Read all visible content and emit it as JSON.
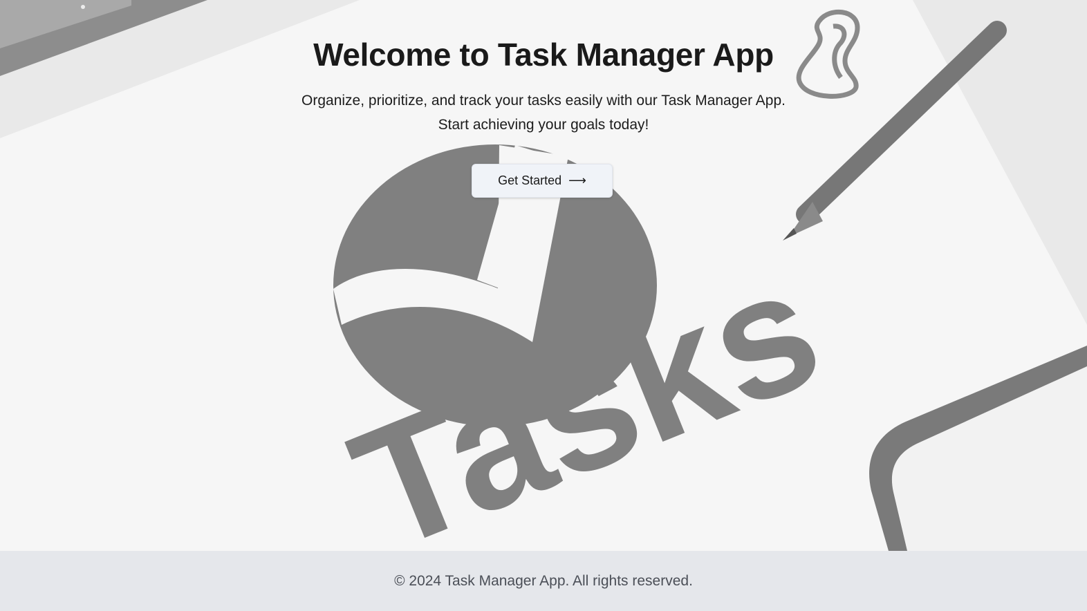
{
  "hero": {
    "title": "Welcome to Task Manager App",
    "subtitle_line1": "Organize, prioritize, and track your tasks easily with our Task Manager App.",
    "subtitle_line2": "Start achieving your goals today!",
    "cta_label": "Get Started",
    "cta_arrow": "⟶"
  },
  "background": {
    "logo_text": "Tasks",
    "icons": [
      "pencil-icon",
      "paperclip-icon",
      "checkmark-logo-icon",
      "tablet-icon",
      "keyboard-icon"
    ],
    "logo_color": "#808080"
  },
  "footer": {
    "copyright": "© 2024 Task Manager App. All rights reserved."
  }
}
